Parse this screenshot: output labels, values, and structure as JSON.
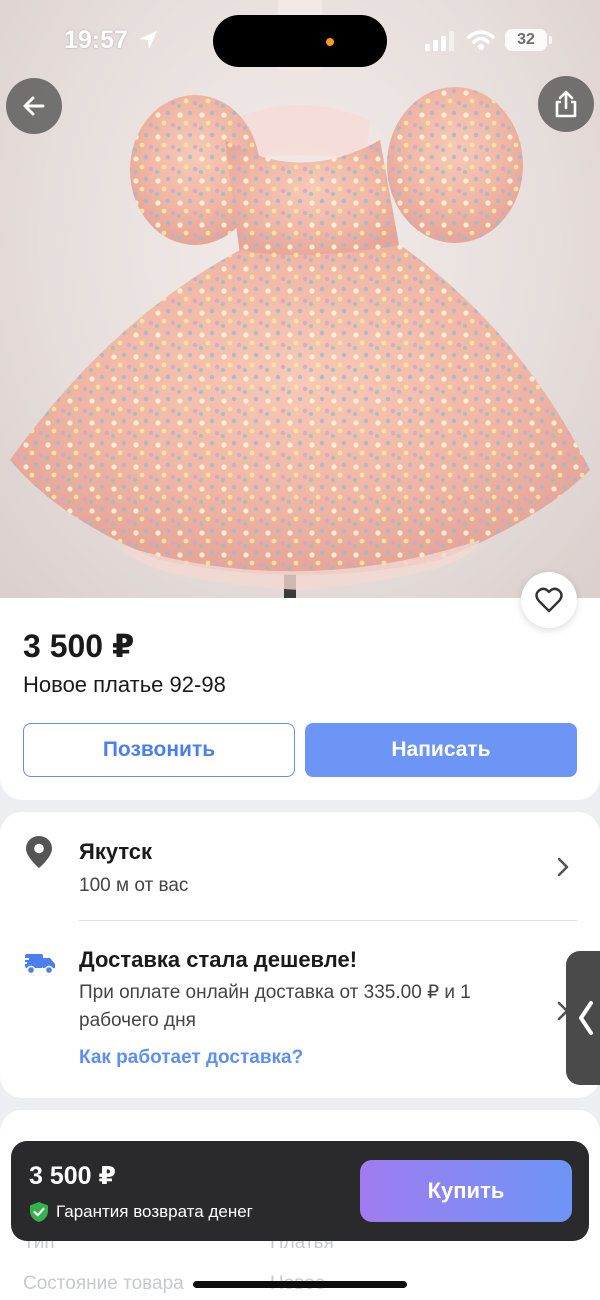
{
  "status_bar": {
    "time": "19:57",
    "battery": "32"
  },
  "listing": {
    "price": "3 500 ₽",
    "title": "Новое платье 92-98",
    "call_label": "Позвонить",
    "write_label": "Написать"
  },
  "location": {
    "city": "Якутск",
    "distance": "100 м от вас"
  },
  "delivery": {
    "title": "Доставка стала дешевле!",
    "text": "При оплате онлайн доставка от 335.00 ₽ и 1 рабочего дня",
    "link": "Как работает доставка?"
  },
  "properties": [
    {
      "label": "Тип",
      "value": "Платья"
    },
    {
      "label": "Состояние товара",
      "value": "Новое"
    }
  ],
  "buy_bar": {
    "price": "3 500 ₽",
    "guarantee": "Гарантия возврата денег",
    "buy_label": "Купить"
  },
  "colors": {
    "accent_blue": "#6d95f6",
    "link_blue": "#5e8ff3",
    "buy_gradient_start": "#a07cf0",
    "guarantee_green": "#35b34a",
    "dark_bar": "#2a2a2c"
  },
  "icons": {
    "back": "arrow-left-icon",
    "share": "share-icon",
    "favorite": "heart-icon",
    "location": "map-pin-icon",
    "delivery": "truck-icon",
    "guarantee": "shield-check-icon",
    "chevron": "chevron-right-icon"
  }
}
